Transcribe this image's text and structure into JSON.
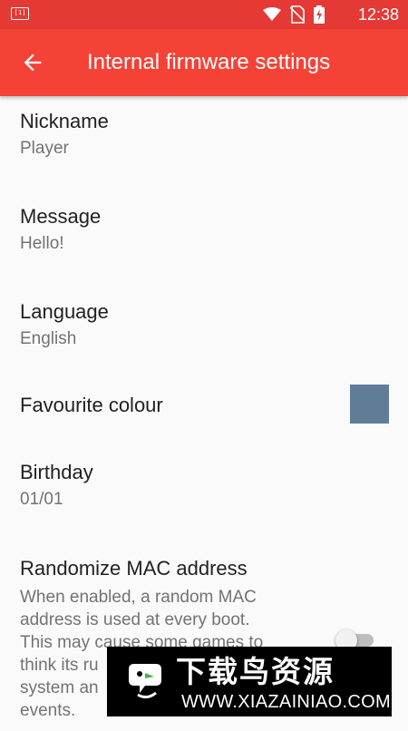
{
  "status_bar": {
    "left_icon": "[1]",
    "icons": [
      "wifi-icon",
      "no-sim-icon",
      "battery-charging-icon"
    ],
    "time": "12:38"
  },
  "app_bar": {
    "back_icon": "arrow-back-icon",
    "title": "Internal firmware settings"
  },
  "settings": {
    "nickname": {
      "label": "Nickname",
      "value": "Player"
    },
    "message": {
      "label": "Message",
      "value": "Hello!"
    },
    "language": {
      "label": "Language",
      "value": "English"
    },
    "favourite_colour": {
      "label": "Favourite colour",
      "color": "#607d97"
    },
    "birthday": {
      "label": "Birthday",
      "value": "01/01"
    },
    "randomize_mac": {
      "label": "Randomize MAC address",
      "description_lines": [
        "When enabled, a random MAC",
        "address is used at every boot.",
        "This may cause some games to",
        "think its ru",
        "system an",
        "events."
      ],
      "enabled": false
    }
  },
  "watermark": {
    "title": "下载鸟资源",
    "url": "WWW.XIAZAINIAO.COM"
  },
  "colors": {
    "status_bar": "#e43935",
    "app_bar": "#f44336",
    "background": "#fafafa"
  }
}
